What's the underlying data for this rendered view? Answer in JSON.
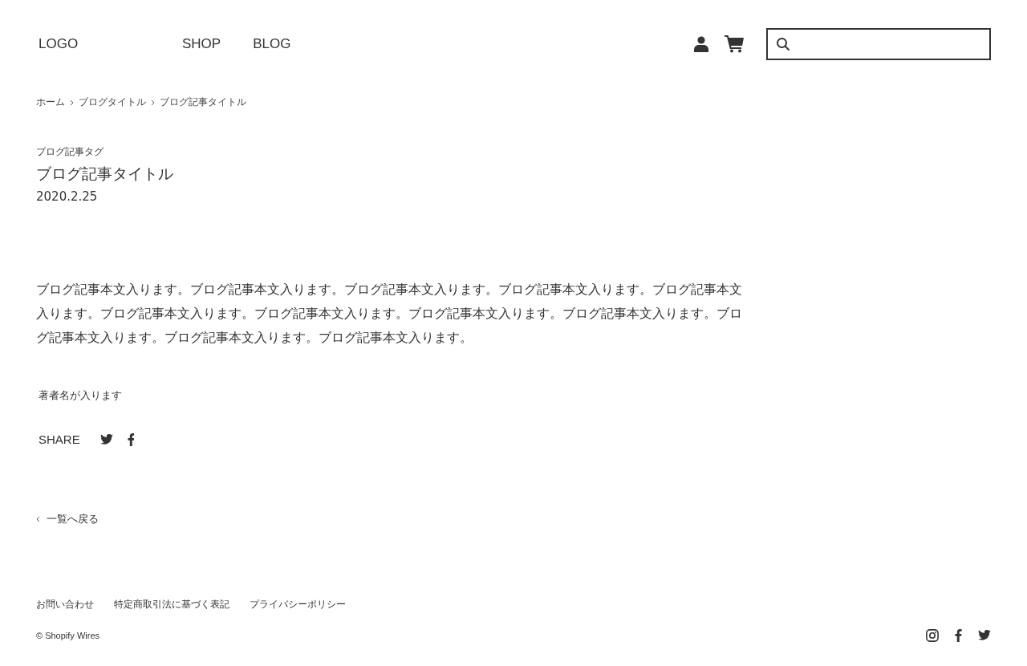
{
  "header": {
    "logo": "LOGO",
    "nav": [
      "SHOP",
      "BLOG"
    ]
  },
  "breadcrumbs": [
    "ホーム",
    "ブログタイトル",
    "ブログ記事タイトル"
  ],
  "article": {
    "tag": "ブログ記事タグ",
    "title": "ブログ記事タイトル",
    "date": "2020.2.25",
    "body": "ブログ記事本文入ります。ブログ記事本文入ります。ブログ記事本文入ります。ブログ記事本文入ります。ブログ記事本文入ります。ブログ記事本文入ります。ブログ記事本文入ります。ブログ記事本文入ります。ブログ記事本文入ります。ブログ記事本文入ります。ブログ記事本文入ります。ブログ記事本文入ります。",
    "author": "著者名が入ります",
    "share_label": "SHARE",
    "share": [
      {
        "kind": "twitter"
      },
      {
        "kind": "facebook"
      }
    ]
  },
  "back_link": "一覧へ戻る",
  "footer": {
    "links": [
      "お問い合わせ",
      "特定商取引法に基づく表記",
      "プライバシーポリシー"
    ],
    "copyright": "© Shopify Wires",
    "social": [
      {
        "kind": "instagram"
      },
      {
        "kind": "facebook"
      },
      {
        "kind": "twitter"
      }
    ]
  }
}
